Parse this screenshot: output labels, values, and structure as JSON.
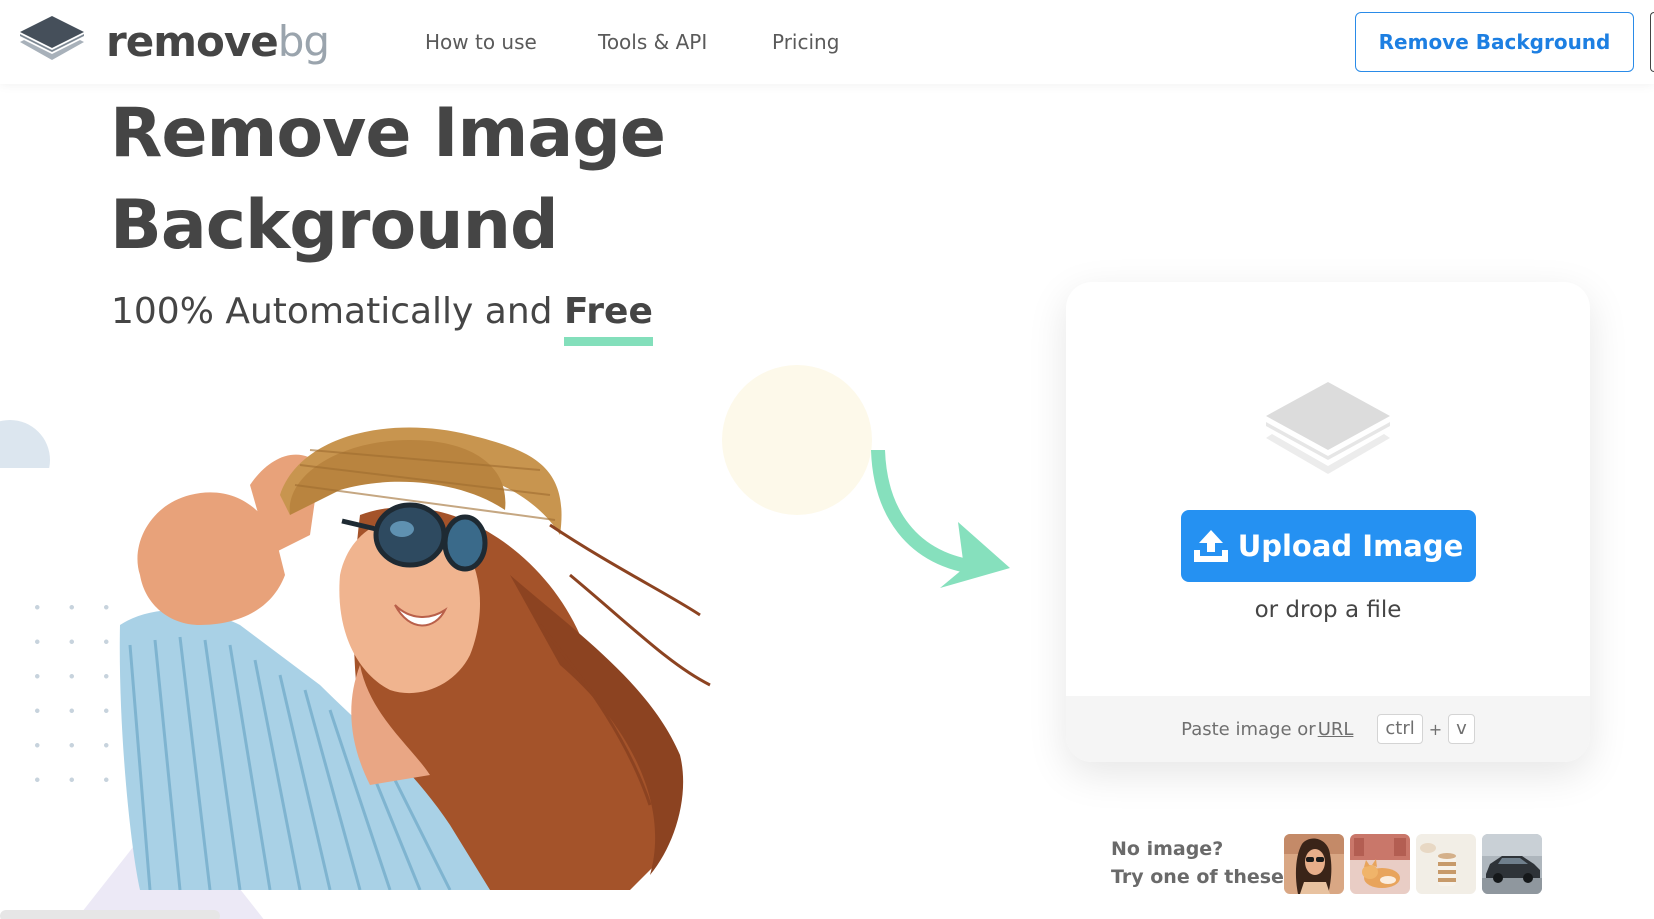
{
  "header": {
    "logo": {
      "word_remove": "remove",
      "word_bg": "bg"
    },
    "nav": [
      "How to use",
      "Tools & API",
      "Pricing"
    ],
    "cta_label": "Remove Background"
  },
  "hero": {
    "title_line1": "Remove Image",
    "title_line2": "Background",
    "subtitle_prefix": "100% Automatically and ",
    "subtitle_emphasis": "Free"
  },
  "upload": {
    "button_label": "Upload Image",
    "drop_text": "or drop a file",
    "paste_prefix": "Paste image or",
    "url_link": "URL",
    "shortcut_key1": "ctrl",
    "shortcut_plus": "+",
    "shortcut_key2": "v"
  },
  "samples": {
    "line1": "No image?",
    "line2": "Try one of these:",
    "thumbnails": [
      "woman-with-sunglasses",
      "cat",
      "cake",
      "car"
    ]
  },
  "colors": {
    "brand_blue": "#2591f2",
    "text_dark": "#454545",
    "accent_green": "#83dfbb",
    "logo_gray": "#9aa4ad"
  }
}
